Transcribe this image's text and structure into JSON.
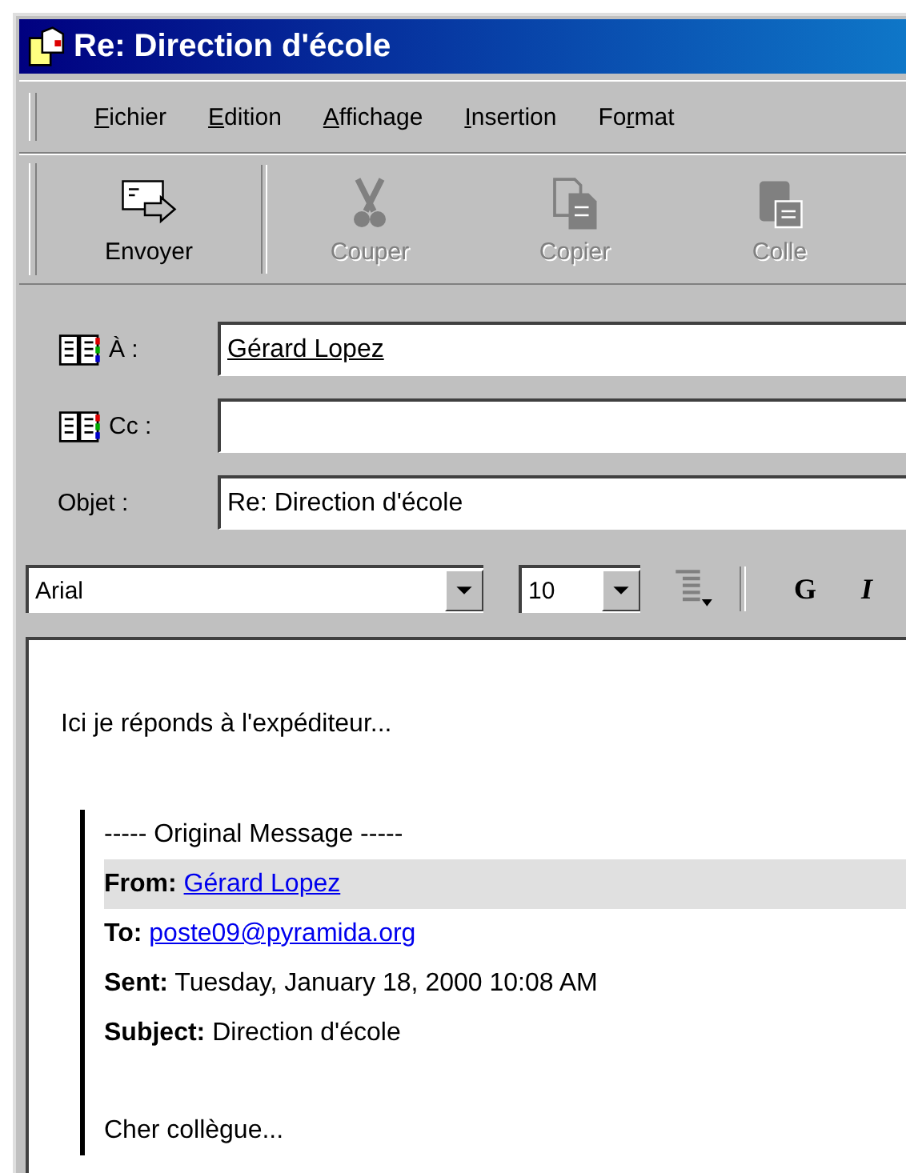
{
  "window": {
    "title": "Re: Direction d'école"
  },
  "menu": [
    {
      "key": "F",
      "post": "ichier"
    },
    {
      "key": "E",
      "post": "dition"
    },
    {
      "key": "A",
      "post": "ffichage"
    },
    {
      "key": "I",
      "post": "nsertion"
    },
    {
      "pre": "Fo",
      "key": "r",
      "post": "mat"
    }
  ],
  "toolbar": [
    {
      "kind": "send",
      "label": "Envoyer",
      "disabled": false
    },
    {
      "kind": "cut",
      "label": "Couper",
      "disabled": true
    },
    {
      "kind": "copy",
      "label": "Copier",
      "disabled": true
    },
    {
      "kind": "paste",
      "label": "Colle",
      "disabled": true
    }
  ],
  "header_fields": [
    {
      "kind": "address",
      "label": "À :",
      "value": "Gérard Lopez"
    },
    {
      "kind": "address",
      "label": "Cc :"
    },
    {
      "kind": "plain",
      "label": "Objet :",
      "value": "Re: Direction d'école"
    }
  ],
  "format_bar": {
    "font": "Arial",
    "size": "10",
    "bold": "G",
    "italic": "I"
  },
  "body": {
    "reply": "Ici je réponds à l'expéditeur...",
    "quote_header": "----- Original Message -----",
    "quote_fields": [
      {
        "label": "From:",
        "value": "Gérard Lopez",
        "kind": "link",
        "selected": true
      },
      {
        "label": "To:",
        "value": "poste09@pyramida.org",
        "kind": "link",
        "selected": false
      },
      {
        "label": "Sent:",
        "value": "Tuesday, January 18, 2000 10:08 AM",
        "kind": "text",
        "selected": false
      },
      {
        "label": "Subject:",
        "value": "Direction d'école",
        "kind": "text",
        "selected": false
      }
    ],
    "quote_text": "Cher collègue..."
  }
}
